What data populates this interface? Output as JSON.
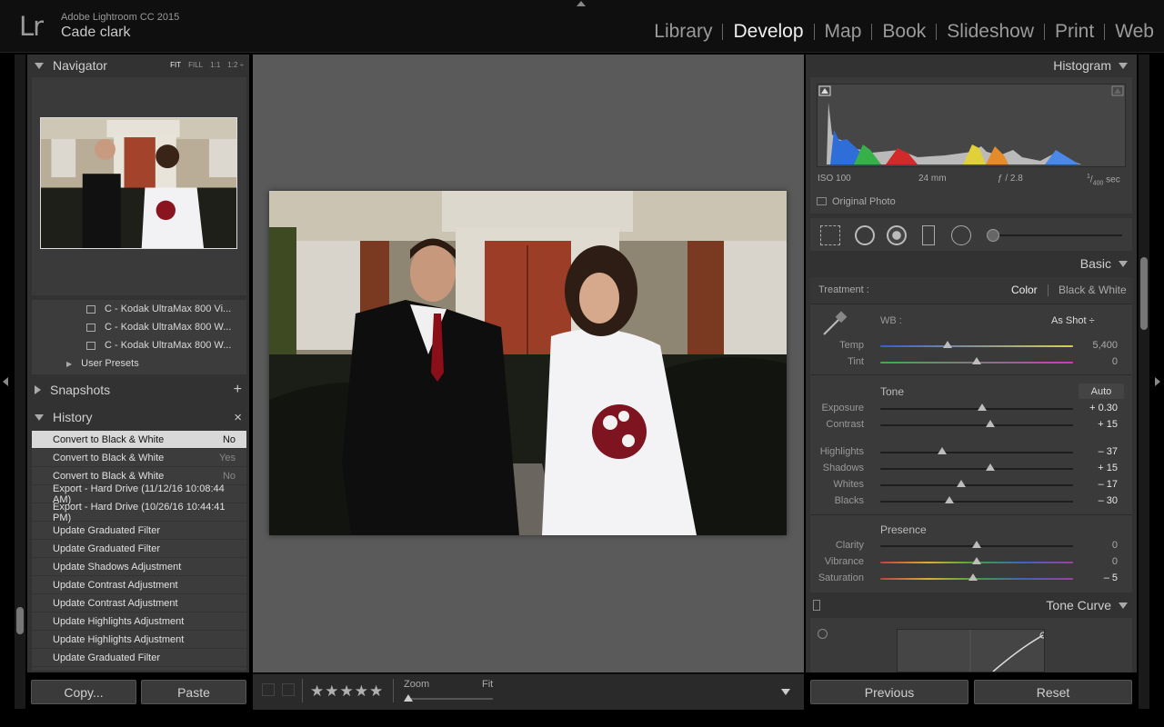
{
  "app": {
    "logo": "Lr",
    "name": "Adobe Lightroom CC 2015",
    "user": "Cade clark"
  },
  "modules": [
    {
      "label": "Library",
      "active": false
    },
    {
      "label": "Develop",
      "active": true
    },
    {
      "label": "Map",
      "active": false
    },
    {
      "label": "Book",
      "active": false
    },
    {
      "label": "Slideshow",
      "active": false
    },
    {
      "label": "Print",
      "active": false
    },
    {
      "label": "Web",
      "active": false
    }
  ],
  "navigator": {
    "title": "Navigator",
    "modes": [
      "FIT",
      "FILL",
      "1:1",
      "1:2 ÷"
    ]
  },
  "presets": {
    "items": [
      "C - Kodak UltraMax 800 Vi...",
      "C - Kodak UltraMax 800 W...",
      "C - Kodak UltraMax 800 W..."
    ],
    "user_presets": "User Presets"
  },
  "snapshots": {
    "title": "Snapshots",
    "add": "+"
  },
  "history": {
    "title": "History",
    "close": "×",
    "items": [
      {
        "label": "Convert to Black & White",
        "value": "No"
      },
      {
        "label": "Convert to Black & White",
        "value": "Yes"
      },
      {
        "label": "Convert to Black & White",
        "value": "No"
      },
      {
        "label": "Export - Hard Drive (11/12/16 10:08:44 AM)",
        "value": ""
      },
      {
        "label": "Export - Hard Drive (10/26/16 10:44:41 PM)",
        "value": ""
      },
      {
        "label": "Update Graduated Filter",
        "value": ""
      },
      {
        "label": "Update Graduated Filter",
        "value": ""
      },
      {
        "label": "Update Shadows Adjustment",
        "value": ""
      },
      {
        "label": "Update Contrast Adjustment",
        "value": ""
      },
      {
        "label": "Update Contrast Adjustment",
        "value": ""
      },
      {
        "label": "Update Highlights Adjustment",
        "value": ""
      },
      {
        "label": "Update Highlights Adjustment",
        "value": ""
      },
      {
        "label": "Update Graduated Filter",
        "value": ""
      }
    ]
  },
  "left_buttons": {
    "copy": "Copy...",
    "paste": "Paste"
  },
  "toolbar": {
    "zoom_label": "Zoom",
    "zoom_value": "Fit",
    "stars": "★★★★★"
  },
  "histogram": {
    "title": "Histogram",
    "iso": "ISO 100",
    "focal": "24 mm",
    "aperture": "ƒ / 2.8",
    "shutter_num": "1",
    "shutter_den": "400",
    "shutter_unit": "sec",
    "original_photo": "Original Photo"
  },
  "basic": {
    "title": "Basic",
    "treatment_label": "Treatment :",
    "treatment_color": "Color",
    "treatment_bw": "Black & White",
    "wb_label": "WB :",
    "wb_value": "As Shot ÷",
    "tone_label": "Tone",
    "auto_label": "Auto",
    "presence_label": "Presence",
    "sliders": [
      {
        "label": "Temp",
        "value": "5,400",
        "pos": 0.35,
        "bright": false
      },
      {
        "label": "Tint",
        "value": "0",
        "pos": 0.5,
        "bright": false
      },
      {
        "label": "Exposure",
        "value": "+ 0.30",
        "pos": 0.53,
        "bright": true
      },
      {
        "label": "Contrast",
        "value": "+ 15",
        "pos": 0.57,
        "bright": true
      },
      {
        "label": "Highlights",
        "value": "– 37",
        "pos": 0.32,
        "bright": true
      },
      {
        "label": "Shadows",
        "value": "+ 15",
        "pos": 0.57,
        "bright": true
      },
      {
        "label": "Whites",
        "value": "– 17",
        "pos": 0.42,
        "bright": true
      },
      {
        "label": "Blacks",
        "value": "– 30",
        "pos": 0.36,
        "bright": true
      },
      {
        "label": "Clarity",
        "value": "0",
        "pos": 0.5,
        "bright": false
      },
      {
        "label": "Vibrance",
        "value": "0",
        "pos": 0.5,
        "bright": false
      },
      {
        "label": "Saturation",
        "value": "– 5",
        "pos": 0.48,
        "bright": true
      }
    ]
  },
  "tone_curve": {
    "title": "Tone Curve"
  },
  "right_buttons": {
    "previous": "Previous",
    "reset": "Reset"
  }
}
